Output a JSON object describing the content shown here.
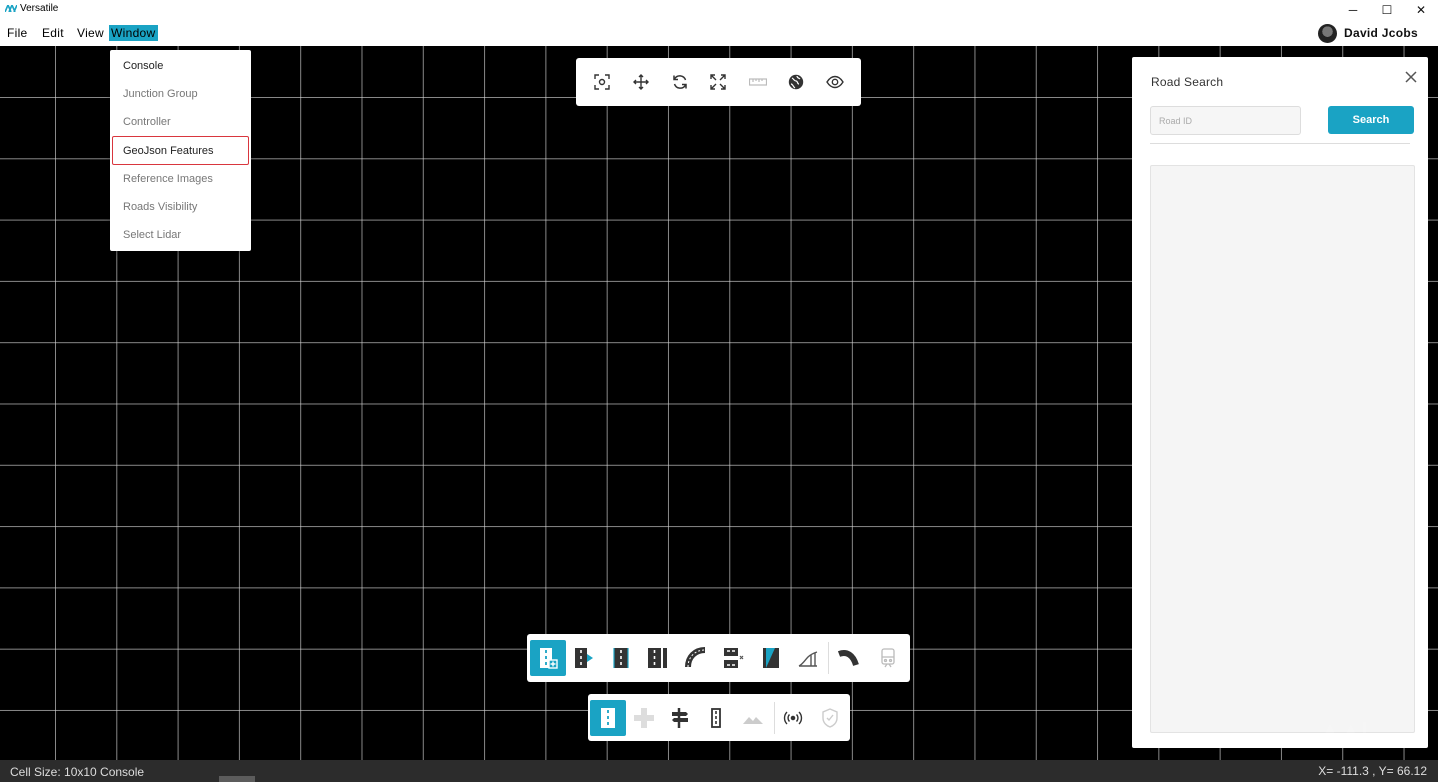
{
  "window": {
    "title": "Versatile",
    "controls": [
      "─",
      "☐",
      "✕"
    ]
  },
  "menubar": {
    "items": [
      "File",
      "Edit",
      "View",
      "Window"
    ],
    "active": "Window"
  },
  "user": {
    "name": "David Jcobs"
  },
  "window_menu": {
    "items": [
      "Console",
      "Junction Group",
      "Controller",
      "GeoJson Features",
      "Reference Images",
      "Roads Visibility",
      "Select Lidar"
    ],
    "highlighted": "GeoJson Features"
  },
  "top_toolbar": {
    "icons": [
      "focus-icon",
      "move-icon",
      "rotate-icon",
      "scale-icon",
      "ruler-icon",
      "globe-icon",
      "eye-icon"
    ]
  },
  "road_search": {
    "title": "Road Search",
    "input_placeholder": "Road ID",
    "search_label": "Search"
  },
  "tools_row1": {
    "icons": [
      "add-road-icon",
      "road-extend-icon",
      "road-lane-icon",
      "road-split-icon",
      "curve-road-icon",
      "road-junction-icon",
      "road-texture-icon",
      "elevation-icon",
      "arc-road-icon",
      "train-icon"
    ],
    "active_index": 0
  },
  "tools_row2": {
    "icons": [
      "lane-icon",
      "junction-cross-icon",
      "signpost-icon",
      "lane-marking-icon",
      "terrain-icon",
      "signal-icon",
      "shield-check-icon"
    ],
    "active_index": 0
  },
  "status": {
    "left": "Cell Size: 10x10  Console",
    "coords": "X= -111.3 , Y= 66.12"
  },
  "colors": {
    "accent": "#1aa3c4",
    "highlight_border": "#d9363e"
  }
}
